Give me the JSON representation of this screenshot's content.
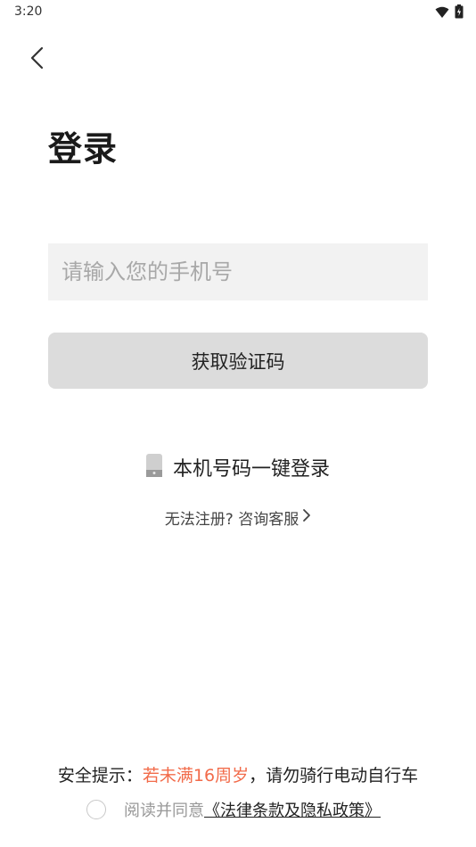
{
  "status_bar": {
    "time": "3:20",
    "icons": [
      "wifi-icon",
      "battery-icon"
    ]
  },
  "header": {
    "back_icon": "chevron-left-icon"
  },
  "main": {
    "title": "登录",
    "phone_input": {
      "value": "",
      "placeholder": "请输入您的手机号"
    },
    "get_code_button": "获取验证码",
    "one_click_login": {
      "icon": "phone-icon",
      "label": "本机号码一键登录"
    },
    "help": {
      "label": "无法注册? 咨询客服",
      "icon": "chevron-right-icon"
    }
  },
  "footer": {
    "safety_prefix": "安全提示：",
    "safety_highlight": "若未满16周岁",
    "safety_suffix": "，请勿骑行电动自行车",
    "agree_prefix": "阅读并同意",
    "policy_link": "《法律条款及隐私政策》"
  },
  "colors": {
    "accent_warning": "#f26b4a",
    "button_bg": "#dcdcdc",
    "input_bg": "#f2f2f2"
  }
}
